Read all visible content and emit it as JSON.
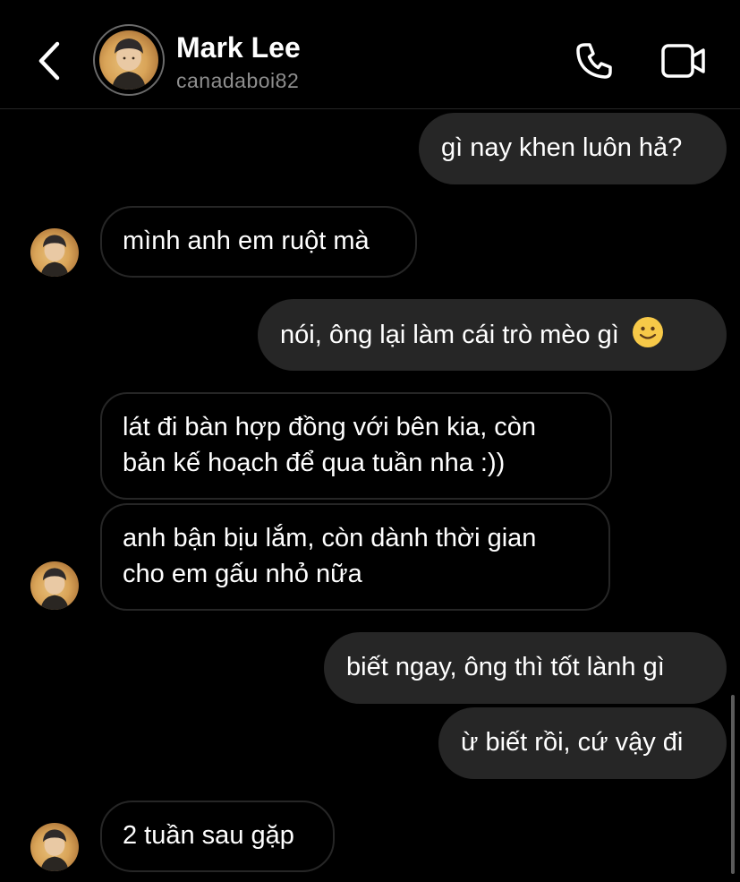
{
  "header": {
    "contact_name": "Mark Lee",
    "username": "canadaboi82",
    "icons": {
      "back": "chevron-left-icon",
      "call": "phone-icon",
      "video": "video-camera-icon"
    }
  },
  "messages": [
    {
      "direction": "outgoing",
      "text": "gì nay khen luôn hả?"
    },
    {
      "direction": "incoming",
      "text": "mình anh em ruột mà"
    },
    {
      "direction": "outgoing",
      "text": "nói, ông lại làm cái trò mèo gì",
      "emoji": "slightly-smiling-face-icon"
    },
    {
      "direction": "incoming",
      "lines": [
        "lát đi bàn hợp đồng với bên kia, còn",
        "bản kế hoạch để qua tuần nha :))"
      ]
    },
    {
      "direction": "incoming",
      "lines": [
        "anh bận bịu lắm, còn dành thời gian",
        "cho em gấu nhỏ nữa"
      ]
    },
    {
      "direction": "outgoing",
      "text": "biết ngay, ông thì tốt lành gì"
    },
    {
      "direction": "outgoing",
      "text": "ừ biết rồi, cứ vậy đi"
    },
    {
      "direction": "incoming",
      "text": "2 tuần sau gặp"
    }
  ],
  "colors": {
    "background": "#000000",
    "outgoing_bubble": "#262626",
    "incoming_border": "#262626",
    "secondary_text": "#8e8e8e",
    "emoji_yellow": "#f7c948"
  }
}
